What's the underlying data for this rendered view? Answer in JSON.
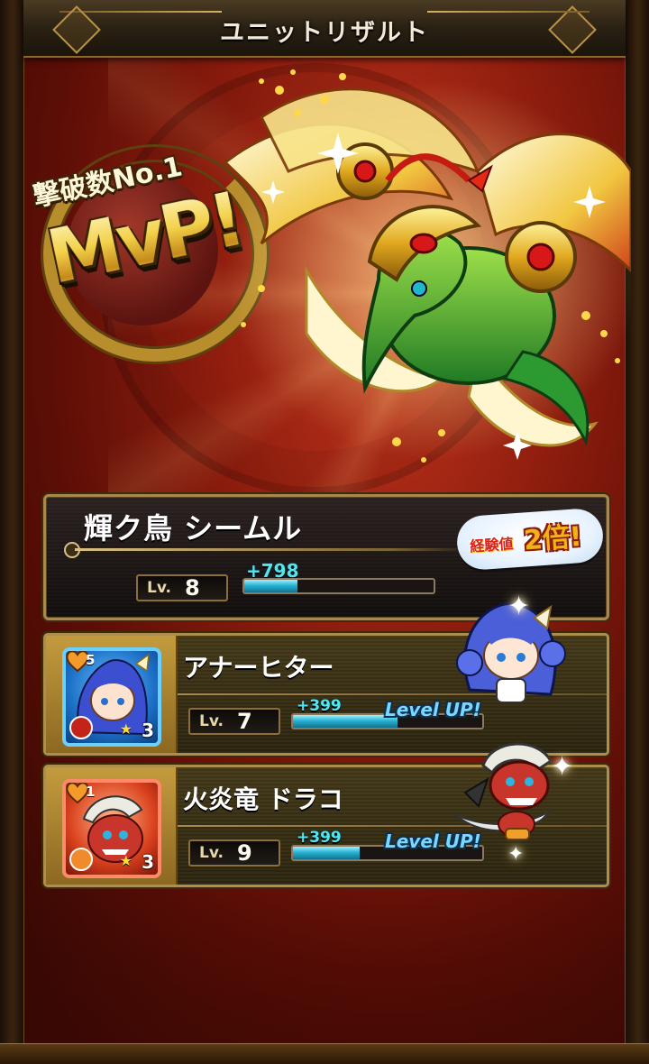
{
  "screen_title": "ユニットリザルト",
  "mvp": {
    "subtitle": "撃破数No.1",
    "label": "MvP!"
  },
  "mvp_unit": {
    "name": "輝ク鳥 シームル",
    "lv_label": "Lv.",
    "level": "8",
    "exp_gain": "+798",
    "exp_progress": 0.28,
    "bonus_small": "経験値",
    "bonus_big": "2倍!"
  },
  "units": [
    {
      "name": "アナーヒター",
      "cost": "5",
      "rarity": "3",
      "lv_label": "Lv.",
      "level": "7",
      "exp_gain": "+399",
      "exp_progress": 0.55,
      "level_up": "Level UP!",
      "card_theme": "blue"
    },
    {
      "name": "火炎竜 ドラコ",
      "cost": "1",
      "rarity": "3",
      "lv_label": "Lv.",
      "level": "9",
      "exp_gain": "+399",
      "exp_progress": 0.35,
      "level_up": "Level UP!",
      "card_theme": "red"
    }
  ],
  "colors": {
    "exp_text": "#56e4ee",
    "exp_fill": "#27b4d6",
    "gold_frame": "#ad8e4a",
    "background_red": "#8e1d0e"
  },
  "icons": [
    "heart-cost-icon",
    "star-rarity-icon",
    "element-icon",
    "sparkle-icon"
  ]
}
